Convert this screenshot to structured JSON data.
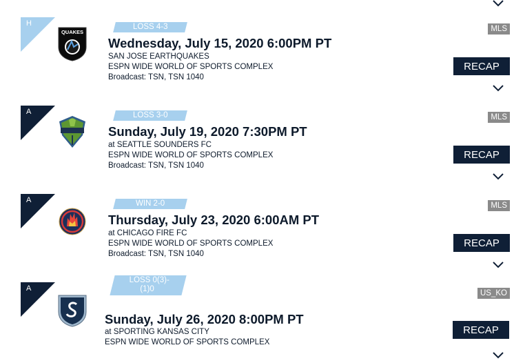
{
  "matches": [
    {
      "venue_letter": "H",
      "result": "LOSS 4-3",
      "date": "Wednesday, July 15, 2020 6:00PM PT",
      "opponent": "SAN JOSE EARTHQUAKES",
      "stadium": "ESPN WIDE WORLD OF SPORTS COMPLEX",
      "broadcast": "Broadcast: TSN, TSN 1040",
      "league": "MLS",
      "recap_label": "RECAP",
      "crest_icon": "quakes-crest-icon",
      "crest_text": "QUAKES"
    },
    {
      "venue_letter": "A",
      "result": "LOSS 3-0",
      "date": "Sunday, July 19, 2020 7:30PM PT",
      "opponent": "at SEATTLE SOUNDERS FC",
      "stadium": "ESPN WIDE WORLD OF SPORTS COMPLEX",
      "broadcast": "Broadcast: TSN, TSN 1040",
      "league": "MLS",
      "recap_label": "RECAP",
      "crest_icon": "sounders-crest-icon"
    },
    {
      "venue_letter": "A",
      "result": "WIN 2-0",
      "date": "Thursday, July 23, 2020 6:00AM PT",
      "opponent": "at CHICAGO FIRE FC",
      "stadium": "ESPN WIDE WORLD OF SPORTS COMPLEX",
      "broadcast": "Broadcast: TSN, TSN 1040",
      "league": "MLS",
      "recap_label": "RECAP",
      "crest_icon": "chicago-fire-crest-icon"
    },
    {
      "venue_letter": "A",
      "result_line1": "LOSS 0(3)-",
      "result_line2": "(1)0",
      "date": "Sunday, July 26, 2020 8:00PM PT",
      "opponent": "at SPORTING KANSAS CITY",
      "stadium": "ESPN WIDE WORLD OF SPORTS COMPLEX",
      "league": "US_KO",
      "recap_label": "RECAP",
      "crest_icon": "sporting-kc-crest-icon"
    }
  ],
  "colors": {
    "navy": "#0f1f36",
    "light_blue": "#a7d0ee",
    "badge_grey": "#8a8a8a"
  }
}
